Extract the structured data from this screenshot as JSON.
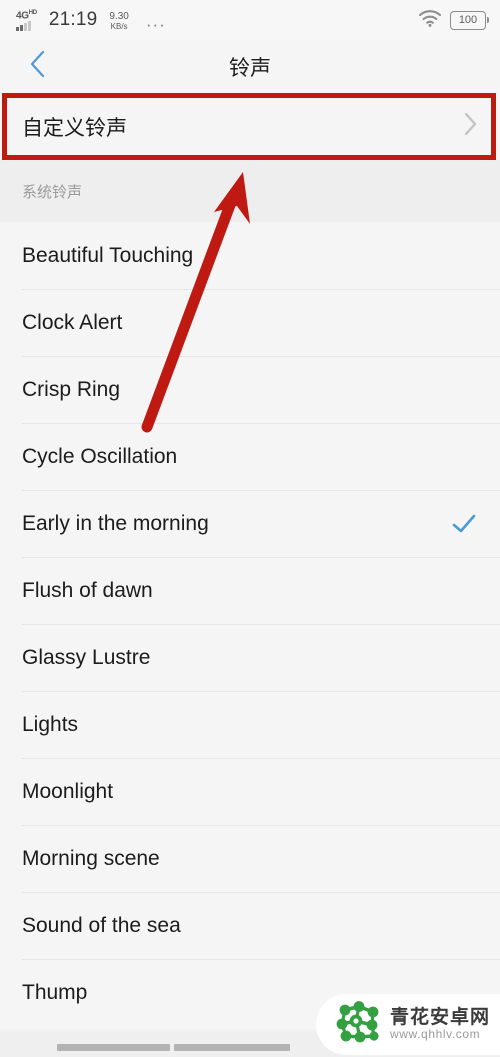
{
  "status_bar": {
    "network_type": "4G",
    "network_suffix": "HD",
    "time": "21:19",
    "net_speed_value": "9.30",
    "net_speed_unit": "KB/s",
    "overflow_dots": "···",
    "wifi_icon": "wifi-icon",
    "battery_level": "100"
  },
  "title_bar": {
    "back_icon": "back-chevron-icon",
    "title": "铃声"
  },
  "custom_row": {
    "label": "自定义铃声",
    "chevron_icon": "chevron-right-icon",
    "highlight_color": "#bf1a12"
  },
  "section": {
    "header": "系统铃声"
  },
  "ringtones": [
    {
      "name": "Beautiful Touching",
      "selected": false
    },
    {
      "name": "Clock Alert",
      "selected": false
    },
    {
      "name": "Crisp Ring",
      "selected": false
    },
    {
      "name": "Cycle Oscillation",
      "selected": false
    },
    {
      "name": "Early in the morning",
      "selected": true
    },
    {
      "name": "Flush of dawn",
      "selected": false
    },
    {
      "name": "Glassy Lustre",
      "selected": false
    },
    {
      "name": "Lights",
      "selected": false
    },
    {
      "name": "Moonlight",
      "selected": false
    },
    {
      "name": "Morning scene",
      "selected": false
    },
    {
      "name": "Sound of the sea",
      "selected": false
    },
    {
      "name": "Thump",
      "selected": false
    }
  ],
  "selection": {
    "check_icon": "check-icon",
    "check_color": "#4c9ad4"
  },
  "annotation": {
    "arrow_icon": "red-arrow-icon",
    "arrow_color": "#bf1a12"
  },
  "watermark": {
    "logo_icon": "molecule-logo-icon",
    "site_name": "青花安卓网",
    "site_url": "www.qhhlv.com",
    "logo_color": "#35a042"
  },
  "nav_bar": {
    "left_pill": "nav-pill-left",
    "right_pill": "nav-pill-right"
  }
}
